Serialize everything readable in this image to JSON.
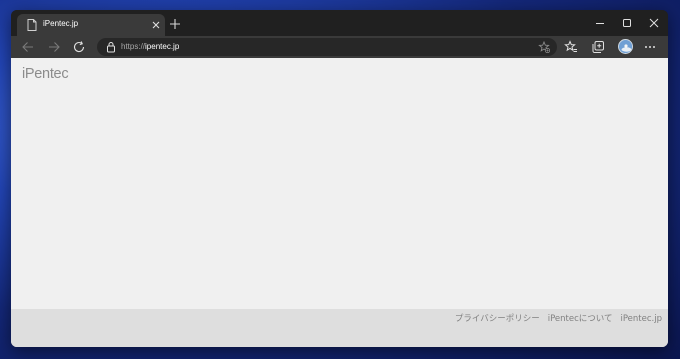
{
  "tab": {
    "title": "iPentec.jp"
  },
  "address": {
    "scheme": "https://",
    "host": "ipentec.jp"
  },
  "logo": {
    "text": "iPentec"
  },
  "footer": {
    "links": [
      "プライバシーポリシー",
      "iPentecについて",
      "iPentec.jp"
    ]
  },
  "colors": {
    "titlebar": "#202020",
    "toolbar": "#3a3a3a",
    "page_bg": "#f0f0f0",
    "footer_bg": "#dedede",
    "footer_text": "#808080",
    "logo": "#8c8c8c"
  },
  "icons": {
    "tab": "page-icon",
    "close": "close-icon",
    "new_tab": "plus-icon",
    "back": "back-arrow-icon",
    "forward": "forward-arrow-icon",
    "reload": "refresh-icon",
    "lock": "lock-icon",
    "favorite_add": "star-add-icon",
    "favorites": "favorites-icon",
    "collections": "collections-icon",
    "profile": "avatar",
    "more": "more-icon",
    "minimize": "minimize-icon",
    "maximize": "maximize-icon",
    "window_close": "window-close-icon"
  }
}
